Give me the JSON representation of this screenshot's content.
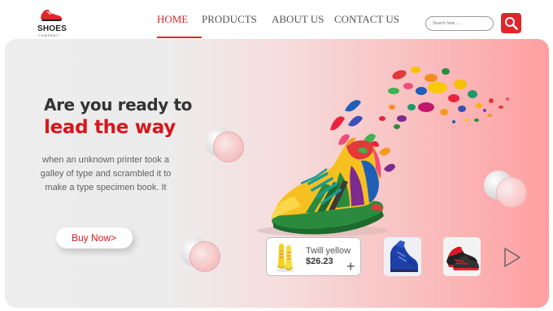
{
  "brand": {
    "name": "SHOES",
    "sub": "COMPANY",
    "accent_color": "#e0262a",
    "logo_icon": "sneaker-icon"
  },
  "nav": {
    "items": [
      {
        "label": "HOME",
        "active": true
      },
      {
        "label": "PRODUCTS",
        "active": false
      },
      {
        "label": "ABOUT US",
        "active": false
      },
      {
        "label": "CONTACT US",
        "active": false
      }
    ]
  },
  "search": {
    "placeholder": "Search Now .....",
    "button_icon": "search-icon"
  },
  "hero": {
    "headline_line1": "Are you ready to",
    "headline_line2": "lead the way",
    "description": "when an unknown printer took a galley of type and scrambled it to make a type specimen book. It",
    "cta_label": "Buy Now",
    "cta_arrow": ">",
    "headline_accent_color": "#d8161c"
  },
  "products": {
    "featured": {
      "name": "Twill yellow",
      "price": "$26.23",
      "add_symbol": "+"
    },
    "thumbnails": [
      {
        "icon": "blue-high-top-sneaker-icon"
      },
      {
        "icon": "red-sneaker-icon"
      }
    ],
    "next_icon": "play-arrow-icon"
  }
}
